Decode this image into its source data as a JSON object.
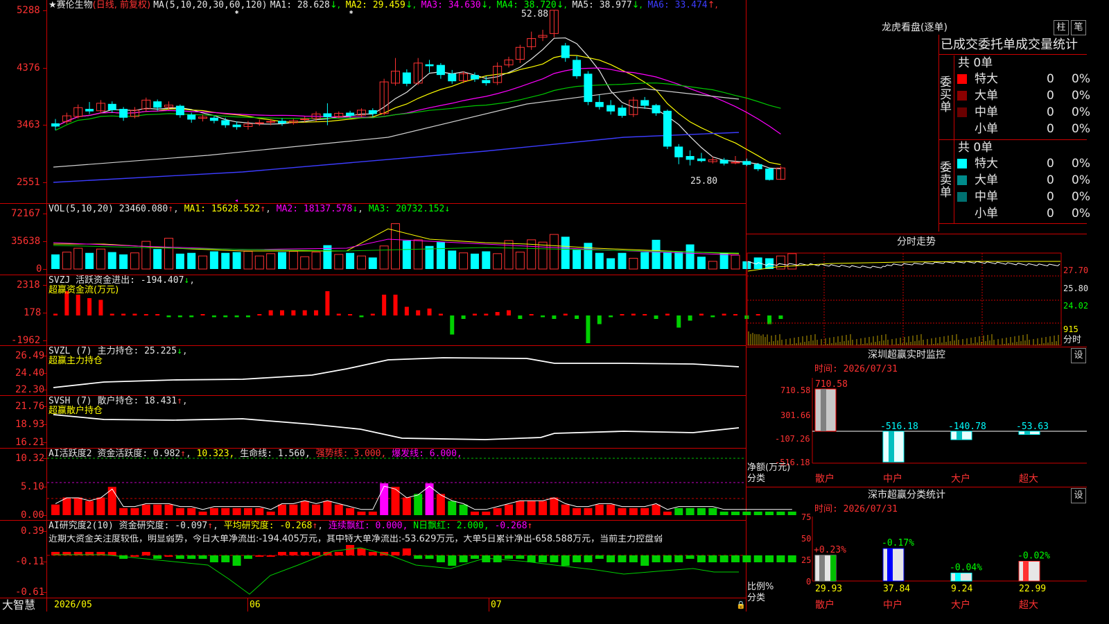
{
  "stock": {
    "star": "★",
    "name": "赛伦生物",
    "mode": "(日线, 前复权)",
    "ma_params": "MA(5,10,20,30,60,120)",
    "ma_values": [
      {
        "label": "MA1: 28.628",
        "arrow": "↓",
        "color": "#e6e6e6"
      },
      {
        "label": "MA2: 29.459",
        "arrow": "↓",
        "color": "#ffff00"
      },
      {
        "label": "MA3: 34.630",
        "arrow": "↓",
        "color": "#ff00ff"
      },
      {
        "label": "MA4: 38.720",
        "arrow": "↓",
        "color": "#00ff00"
      },
      {
        "label": "MA5: 38.977",
        "arrow": "↓",
        "color": "#e6e6e6"
      },
      {
        "label": "MA6: 33.474",
        "arrow": "↑",
        "color": "#3c3cff"
      }
    ],
    "high_label": "52.88",
    "low_label": "25.80"
  },
  "price_axis": [
    "5288",
    "4376",
    "3463",
    "2551"
  ],
  "vol_panel": {
    "title": "VOL(5,10,20)",
    "value": "23460.080",
    "ma1": "MA1: 15628.522",
    "ma2": "MA2: 18137.578",
    "ma3": "MA3: 20732.152",
    "axis": [
      "72167",
      "35638",
      "0"
    ]
  },
  "svzj_panel": {
    "title": "SVZJ",
    "label": "活跃资金进出: -194.407",
    "subtitle": "超赢资金流(万元)",
    "axis": [
      "2318",
      "178",
      "-1962"
    ]
  },
  "svzl_panel": {
    "title": "SVZL (7)",
    "label": "主力持仓: 25.225",
    "subtitle": "超赢主力持仓",
    "axis": [
      "26.49",
      "24.40",
      "22.30"
    ]
  },
  "svsh_panel": {
    "title": "SVSH (7)",
    "label": "散户持仓: 18.431",
    "subtitle": "超赢散户持仓",
    "axis": [
      "21.76",
      "18.93",
      "16.21"
    ]
  },
  "ai_active_panel": {
    "title": "AI活跃度2",
    "label1": "资金活跃度: 0.982",
    "label2": "10.323,",
    "label3": "生命线: 1.560,",
    "label4": "强势线: 3.000,",
    "label5": "爆发线: 6.000,",
    "axis": [
      "10.32",
      "5.10",
      "0.00"
    ]
  },
  "ai_research_panel": {
    "title": "AI研究度2(10)",
    "label1": "资金研究度: -0.097",
    "label2": "平均研究度: -0.268",
    "label3": "连续飘红: 0.000,",
    "label4": "N日飘红: 2.000,",
    "label5": "-0.268",
    "comment": "近期大资金关注度较低，明显弱势，今日大单净流出:-194.405万元，其中特大单净流出:-53.629万元，大单5日累计净出-658.588万元，当前主力控盘弱",
    "axis": [
      "0.39",
      "-0.11",
      "-0.61"
    ]
  },
  "bottom_axis": {
    "brand": "大智慧",
    "dates": [
      "2026/05",
      "06",
      "07"
    ]
  },
  "right_panel": {
    "title": "龙虎看盘(逐单)",
    "btn_bar": "柱",
    "btn_pen": "笔",
    "header": "已成交委托单成交量统计",
    "buy_side": "委买单",
    "sell_side": "委卖单",
    "buy_total": "共 0单",
    "sell_total": "共 0单",
    "rows_buy": [
      {
        "name": "特大",
        "qty": "0",
        "pct": "0%",
        "color": "#ff0000"
      },
      {
        "name": "大单",
        "qty": "0",
        "pct": "0%",
        "color": "#8b0000"
      },
      {
        "name": "中单",
        "qty": "0",
        "pct": "0%",
        "color": "#6a0000"
      },
      {
        "name": "小单",
        "qty": "0",
        "pct": "0%",
        "color": ""
      }
    ],
    "rows_sell": [
      {
        "name": "特大",
        "qty": "0",
        "pct": "0%",
        "color": "#00ffff"
      },
      {
        "name": "大单",
        "qty": "0",
        "pct": "0%",
        "color": "#008b8b"
      },
      {
        "name": "中单",
        "qty": "0",
        "pct": "0%",
        "color": "#007070"
      },
      {
        "name": "小单",
        "qty": "0",
        "pct": "0%",
        "color": ""
      }
    ]
  },
  "intraday": {
    "title": "分时走势",
    "axis": [
      "27.70",
      "25.80",
      "24.02",
      "915",
      "分时"
    ]
  },
  "sz_monitor": {
    "title": "深圳超赢实时监控",
    "btn": "设",
    "time": "时间: 2026/07/31",
    "axis": [
      "710.58",
      "301.66",
      "-107.26",
      "-516.18"
    ],
    "unit": "净额(万元)",
    "cat": "分类",
    "bars": [
      {
        "label": "散户",
        "value": "710.58"
      },
      {
        "label": "中户",
        "value": "-516.18"
      },
      {
        "label": "大户",
        "value": "-140.78"
      },
      {
        "label": "超大",
        "value": "-53.63"
      }
    ]
  },
  "sz_class": {
    "title": "深市超赢分类统计",
    "btn": "设",
    "time": "时间: 2026/07/31",
    "axis": [
      "75",
      "50",
      "25",
      "0"
    ],
    "unit": "比例%",
    "cat": "分类",
    "bars": [
      {
        "label": "散户",
        "value": "29.93",
        "change": "+0.23%"
      },
      {
        "label": "中户",
        "value": "37.84",
        "change": "-0.17%"
      },
      {
        "label": "大户",
        "value": "9.24",
        "change": "-0.04%"
      },
      {
        "label": "超大",
        "value": "22.99",
        "change": "-0.02%"
      }
    ]
  }
}
